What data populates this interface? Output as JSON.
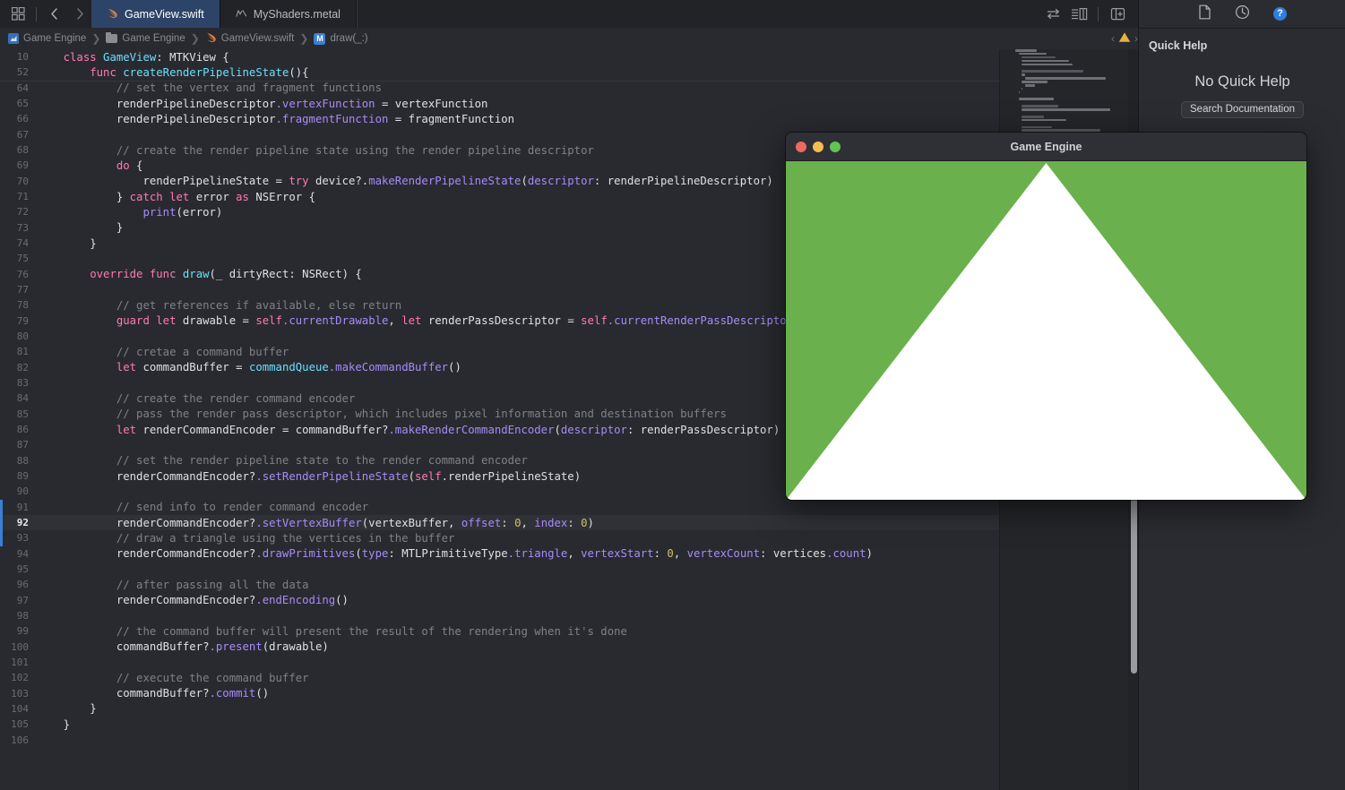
{
  "tabbar": {
    "grid_icon": "grid-icon",
    "back_label": "‹",
    "forward_label": "›",
    "tabs": [
      {
        "label": "GameView.swift",
        "icon": "swift-file-icon",
        "active": true
      },
      {
        "label": "MyShaders.metal",
        "icon": "metal-file-icon",
        "active": false
      }
    ],
    "right_icons": [
      "swap-editors-icon",
      "editor-options-icon",
      "add-editor-icon"
    ]
  },
  "breadcrumb": {
    "items": [
      {
        "label": "Game Engine",
        "icon": "project-icon"
      },
      {
        "label": "Game Engine",
        "icon": "folder-icon"
      },
      {
        "label": "GameView.swift",
        "icon": "swift-file-icon"
      },
      {
        "label": "draw(_:)",
        "icon": "method-badge-icon"
      }
    ],
    "separator": "❯",
    "issue_prev": "‹",
    "issue_next": "›",
    "issue_icon": "warning-triangle-icon"
  },
  "editor": {
    "current_line": 92,
    "sticky": [
      {
        "num": "10",
        "tokens": [
          {
            "t": "    ",
            "c": "plain"
          },
          {
            "t": "class ",
            "c": "kw"
          },
          {
            "t": "GameView",
            "c": "type"
          },
          {
            "t": ": ",
            "c": "plain"
          },
          {
            "t": "MTKView",
            "c": "plain"
          },
          {
            "t": " {",
            "c": "plain"
          }
        ]
      },
      {
        "num": "52",
        "tokens": [
          {
            "t": "        ",
            "c": "plain"
          },
          {
            "t": "func ",
            "c": "kw"
          },
          {
            "t": "createRenderPipelineState",
            "c": "decl"
          },
          {
            "t": "(){",
            "c": "plain"
          }
        ]
      }
    ],
    "lines": [
      {
        "num": "64",
        "tokens": [
          {
            "t": "            // set the vertex and fragment functions",
            "c": "com"
          }
        ]
      },
      {
        "num": "65",
        "tokens": [
          {
            "t": "            renderPipelineDescriptor",
            "c": "plain"
          },
          {
            "t": ".vertexFunction",
            "c": "fn"
          },
          {
            "t": " = vertexFunction",
            "c": "plain"
          }
        ]
      },
      {
        "num": "66",
        "tokens": [
          {
            "t": "            renderPipelineDescriptor",
            "c": "plain"
          },
          {
            "t": ".fragmentFunction",
            "c": "fn"
          },
          {
            "t": " = fragmentFunction",
            "c": "plain"
          }
        ]
      },
      {
        "num": "67",
        "tokens": []
      },
      {
        "num": "68",
        "tokens": [
          {
            "t": "            // create the render pipeline state using the render pipeline descriptor",
            "c": "com"
          }
        ]
      },
      {
        "num": "69",
        "tokens": [
          {
            "t": "            ",
            "c": "plain"
          },
          {
            "t": "do",
            "c": "kw"
          },
          {
            "t": " {",
            "c": "plain"
          }
        ]
      },
      {
        "num": "70",
        "tokens": [
          {
            "t": "                renderPipelineState = ",
            "c": "plain"
          },
          {
            "t": "try ",
            "c": "kw"
          },
          {
            "t": "device",
            "c": "plain"
          },
          {
            "t": "?.",
            "c": "plain"
          },
          {
            "t": "makeRenderPipelineState",
            "c": "fn"
          },
          {
            "t": "(",
            "c": "plain"
          },
          {
            "t": "descriptor",
            "c": "fn"
          },
          {
            "t": ": renderPipelineDescriptor)",
            "c": "plain"
          }
        ]
      },
      {
        "num": "71",
        "tokens": [
          {
            "t": "            } ",
            "c": "plain"
          },
          {
            "t": "catch let ",
            "c": "kw"
          },
          {
            "t": "error ",
            "c": "plain"
          },
          {
            "t": "as ",
            "c": "kw"
          },
          {
            "t": "NSError",
            "c": "plain"
          },
          {
            "t": " {",
            "c": "plain"
          }
        ]
      },
      {
        "num": "72",
        "tokens": [
          {
            "t": "                ",
            "c": "plain"
          },
          {
            "t": "print",
            "c": "fn"
          },
          {
            "t": "(error)",
            "c": "plain"
          }
        ]
      },
      {
        "num": "73",
        "tokens": [
          {
            "t": "            }",
            "c": "plain"
          }
        ]
      },
      {
        "num": "74",
        "tokens": [
          {
            "t": "        }",
            "c": "plain"
          }
        ]
      },
      {
        "num": "75",
        "tokens": []
      },
      {
        "num": "76",
        "tokens": [
          {
            "t": "        ",
            "c": "plain"
          },
          {
            "t": "override func ",
            "c": "kw"
          },
          {
            "t": "draw",
            "c": "decl"
          },
          {
            "t": "(_ dirtyRect: ",
            "c": "plain"
          },
          {
            "t": "NSRect",
            "c": "plain"
          },
          {
            "t": ") {",
            "c": "plain"
          }
        ]
      },
      {
        "num": "77",
        "tokens": []
      },
      {
        "num": "78",
        "tokens": [
          {
            "t": "            // get references if available, else return",
            "c": "com"
          }
        ]
      },
      {
        "num": "79",
        "tokens": [
          {
            "t": "            ",
            "c": "plain"
          },
          {
            "t": "guard let ",
            "c": "kw"
          },
          {
            "t": "drawable = ",
            "c": "plain"
          },
          {
            "t": "self",
            "c": "kw"
          },
          {
            "t": ".currentDrawable",
            "c": "fn"
          },
          {
            "t": ", ",
            "c": "plain"
          },
          {
            "t": "let ",
            "c": "kw"
          },
          {
            "t": "renderPassDescriptor = ",
            "c": "plain"
          },
          {
            "t": "self",
            "c": "kw"
          },
          {
            "t": ".currentRenderPassDescriptor",
            "c": "fn"
          },
          {
            "t": " (",
            "c": "plain"
          }
        ]
      },
      {
        "num": "80",
        "tokens": []
      },
      {
        "num": "81",
        "tokens": [
          {
            "t": "            // cretae a command buffer",
            "c": "com"
          }
        ]
      },
      {
        "num": "82",
        "tokens": [
          {
            "t": "            ",
            "c": "plain"
          },
          {
            "t": "let ",
            "c": "kw"
          },
          {
            "t": "commandBuffer = ",
            "c": "plain"
          },
          {
            "t": "commandQueue",
            "c": "type"
          },
          {
            "t": ".makeCommandBuffer",
            "c": "fn"
          },
          {
            "t": "()",
            "c": "plain"
          }
        ]
      },
      {
        "num": "83",
        "tokens": []
      },
      {
        "num": "84",
        "tokens": [
          {
            "t": "            // create the render command encoder",
            "c": "com"
          }
        ]
      },
      {
        "num": "85",
        "tokens": [
          {
            "t": "            // pass the render pass descriptor, which includes pixel information and destination buffers",
            "c": "com"
          }
        ]
      },
      {
        "num": "86",
        "tokens": [
          {
            "t": "            ",
            "c": "plain"
          },
          {
            "t": "let ",
            "c": "kw"
          },
          {
            "t": "renderCommandEncoder = commandBuffer?",
            "c": "plain"
          },
          {
            "t": ".makeRenderCommandEncoder",
            "c": "fn"
          },
          {
            "t": "(",
            "c": "plain"
          },
          {
            "t": "descriptor",
            "c": "fn"
          },
          {
            "t": ": renderPassDescriptor)",
            "c": "plain"
          }
        ]
      },
      {
        "num": "87",
        "tokens": []
      },
      {
        "num": "88",
        "tokens": [
          {
            "t": "            // set the render pipeline state to the render command encoder",
            "c": "com"
          }
        ]
      },
      {
        "num": "89",
        "tokens": [
          {
            "t": "            renderCommandEncoder?",
            "c": "plain"
          },
          {
            "t": ".setRenderPipelineState",
            "c": "fn"
          },
          {
            "t": "(",
            "c": "plain"
          },
          {
            "t": "self",
            "c": "kw"
          },
          {
            "t": ".renderPipelineState",
            "c": "plain"
          },
          {
            "t": ")",
            "c": "plain"
          }
        ]
      },
      {
        "num": "90",
        "tokens": []
      },
      {
        "num": "91",
        "tokens": [
          {
            "t": "            // send info to render command encoder",
            "c": "com"
          }
        ]
      },
      {
        "num": "92",
        "tokens": [
          {
            "t": "            renderCommandEncoder?",
            "c": "plain"
          },
          {
            "t": ".setVertexBuffer",
            "c": "fn"
          },
          {
            "t": "(vertexBuffer, ",
            "c": "plain"
          },
          {
            "t": "offset",
            "c": "fn"
          },
          {
            "t": ": ",
            "c": "plain"
          },
          {
            "t": "0",
            "c": "num"
          },
          {
            "t": ", ",
            "c": "plain"
          },
          {
            "t": "index",
            "c": "fn"
          },
          {
            "t": ": ",
            "c": "plain"
          },
          {
            "t": "0",
            "c": "num"
          },
          {
            "t": ")",
            "c": "plain"
          }
        ],
        "current": true
      },
      {
        "num": "93",
        "tokens": [
          {
            "t": "            // draw a triangle using the vertices in the buffer",
            "c": "com"
          }
        ]
      },
      {
        "num": "94",
        "tokens": [
          {
            "t": "            renderCommandEncoder?",
            "c": "plain"
          },
          {
            "t": ".drawPrimitives",
            "c": "fn"
          },
          {
            "t": "(",
            "c": "plain"
          },
          {
            "t": "type",
            "c": "fn"
          },
          {
            "t": ": MTLPrimitiveType",
            "c": "plain"
          },
          {
            "t": ".triangle",
            "c": "fn"
          },
          {
            "t": ", ",
            "c": "plain"
          },
          {
            "t": "vertexStart",
            "c": "fn"
          },
          {
            "t": ": ",
            "c": "plain"
          },
          {
            "t": "0",
            "c": "num"
          },
          {
            "t": ", ",
            "c": "plain"
          },
          {
            "t": "vertexCount",
            "c": "fn"
          },
          {
            "t": ": vertices",
            "c": "plain"
          },
          {
            "t": ".count",
            "c": "fn"
          },
          {
            "t": ")",
            "c": "plain"
          }
        ]
      },
      {
        "num": "95",
        "tokens": []
      },
      {
        "num": "96",
        "tokens": [
          {
            "t": "            // after passing all the data",
            "c": "com"
          }
        ]
      },
      {
        "num": "97",
        "tokens": [
          {
            "t": "            renderCommandEncoder?",
            "c": "plain"
          },
          {
            "t": ".endEncoding",
            "c": "fn"
          },
          {
            "t": "()",
            "c": "plain"
          }
        ]
      },
      {
        "num": "98",
        "tokens": []
      },
      {
        "num": "99",
        "tokens": [
          {
            "t": "            // the command buffer will present the result of the rendering when it's done",
            "c": "com"
          }
        ]
      },
      {
        "num": "100",
        "tokens": [
          {
            "t": "            commandBuffer?",
            "c": "plain"
          },
          {
            "t": ".present",
            "c": "fn"
          },
          {
            "t": "(drawable)",
            "c": "plain"
          }
        ]
      },
      {
        "num": "101",
        "tokens": []
      },
      {
        "num": "102",
        "tokens": [
          {
            "t": "            // execute the command buffer",
            "c": "com"
          }
        ]
      },
      {
        "num": "103",
        "tokens": [
          {
            "t": "            commandBuffer?",
            "c": "plain"
          },
          {
            "t": ".commit",
            "c": "fn"
          },
          {
            "t": "()",
            "c": "plain"
          }
        ]
      },
      {
        "num": "104",
        "tokens": [
          {
            "t": "        }",
            "c": "plain"
          }
        ]
      },
      {
        "num": "105",
        "tokens": [
          {
            "t": "    }",
            "c": "plain"
          }
        ]
      },
      {
        "num": "106",
        "tokens": []
      }
    ]
  },
  "inspector": {
    "toolbar_icons": [
      "document-icon",
      "history-clock-icon",
      "quick-help-icon"
    ],
    "title": "Quick Help",
    "empty_message": "No Quick Help",
    "search_button": "Search Documentation"
  },
  "game_window": {
    "title": "Game Engine",
    "lights": [
      "close",
      "minimize",
      "zoom"
    ],
    "render": {
      "background_color": "#6AB04C",
      "triangle_color": "#FFFFFF",
      "shape": "triangle"
    }
  },
  "colors": {
    "accent_blue": "#3b7fd4",
    "active_tab_bg": "#2c4468",
    "editor_bg": "#292a2f",
    "green": "#6AB04C",
    "warning_yellow": "#e8b33a",
    "light_red": "#ed6a5f",
    "light_yellow": "#f5bd4f",
    "light_green": "#61c554"
  }
}
